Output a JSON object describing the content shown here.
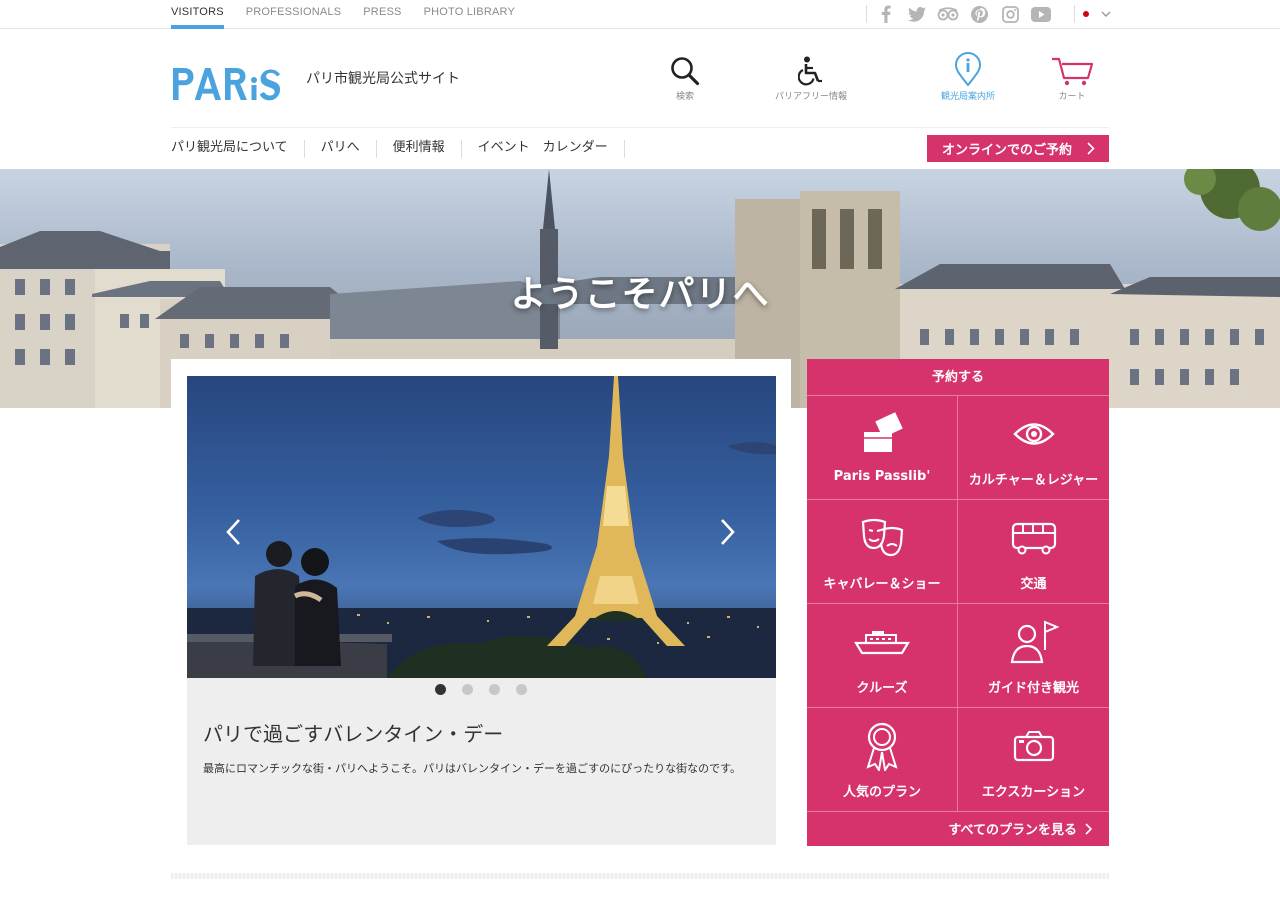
{
  "top_nav": {
    "items": [
      {
        "label": "VISITORS",
        "active": true
      },
      {
        "label": "PROFESSIONALS",
        "active": false
      },
      {
        "label": "PRESS",
        "active": false
      },
      {
        "label": "PHOTO LIBRARY",
        "active": false
      }
    ]
  },
  "social": [
    "facebook-icon",
    "twitter-icon",
    "tripadvisor-icon",
    "pinterest-icon",
    "instagram-icon",
    "youtube-icon"
  ],
  "header": {
    "logo_text": "PARiS",
    "tagline": "パリ市観光局公式サイト",
    "icons": {
      "search": "検索",
      "accessibility": "パリアフリー情報",
      "info": "観光局案内所",
      "cart": "カート"
    }
  },
  "main_nav": {
    "items": [
      "パリ観光局について",
      "パリへ",
      "便利情報",
      "イベント　カレンダー"
    ],
    "book_button": "オンラインでのご予約"
  },
  "hero": {
    "title": "ようこそパリへ"
  },
  "slider": {
    "dots": 4,
    "active_dot": 0,
    "title": "パリで過ごすバレンタイン・デー",
    "text": "最高にロマンチックな街・パリへようこそ。パリはバレンタイン・デーを過ごすのにぴったりな街なのです。"
  },
  "booking": {
    "header": "予約する",
    "items": [
      {
        "label": "Paris Passlib'",
        "icon": "tickets-icon"
      },
      {
        "label": "カルチャー＆レジャー",
        "icon": "eye-icon"
      },
      {
        "label": "キャバレー＆ショー",
        "icon": "theater-masks-icon"
      },
      {
        "label": "交通",
        "icon": "bus-icon"
      },
      {
        "label": "クルーズ",
        "icon": "boat-icon"
      },
      {
        "label": "ガイド付き観光",
        "icon": "guide-icon"
      },
      {
        "label": "人気のプラン",
        "icon": "award-icon"
      },
      {
        "label": "エクスカーション",
        "icon": "camera-icon"
      }
    ],
    "see_all": "すべてのプランを見る"
  },
  "colors": {
    "brand_blue": "#4aa3df",
    "brand_pink": "#d6336c"
  }
}
